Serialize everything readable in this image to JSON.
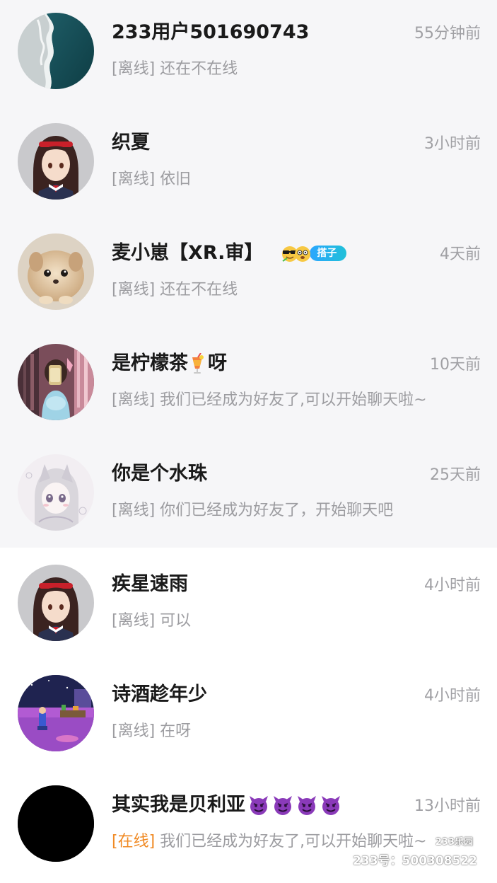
{
  "contacts": [
    {
      "name": "233用户501690743",
      "time": "55分钟前",
      "status": "[离线]",
      "message": "还在不在线",
      "avatar": "ocean-wave-avatar"
    },
    {
      "name": "织夏",
      "time": "3小时前",
      "status": "[离线]",
      "message": "依旧",
      "avatar": "anime-girl-avatar"
    },
    {
      "name": "麦小崽【XR.审】",
      "time": "4天前",
      "status": "[离线]",
      "message": "还在不在线",
      "avatar": "fluffy-pet-avatar",
      "badge": "搭子",
      "badge_icon": "sunglasses-emoji-pair"
    },
    {
      "name": "是柠檬茶",
      "name_suffix": "呀",
      "name_emoji": "tropical-drink-emoji",
      "time": "10天前",
      "status": "[离线]",
      "message": "我们已经成为好友了,可以开始聊天啦~",
      "avatar": "photo-selfie-avatar"
    },
    {
      "name": "你是个水珠",
      "time": "25天前",
      "status": "[离线]",
      "message": "你们已经成为好友了，开始聊天吧",
      "avatar": "anime-sketch-avatar"
    },
    {
      "name": "疾星速雨",
      "time": "4小时前",
      "status": "[离线]",
      "message": "可以",
      "avatar": "anime-girl-avatar"
    },
    {
      "name": "诗酒趁年少",
      "time": "4小时前",
      "status": "[离线]",
      "message": "在呀",
      "avatar": "purple-room-avatar"
    },
    {
      "name": "其实我是贝利亚",
      "name_emoji": "smiling-imp-emoji",
      "name_emoji_count": 4,
      "time": "13小时前",
      "status": "[在线]",
      "message": "我们已经成为好友了,可以开始聊天啦~",
      "avatar": "black-avatar",
      "online": true
    }
  ],
  "watermark": {
    "logo": "233乐园",
    "id": "233号：500308522"
  },
  "colors": {
    "pinned_background": "#f6f6f8",
    "online_status": "#f08a24",
    "secondary_text": "#9c9ca0",
    "name_text": "#1a1a1a"
  }
}
